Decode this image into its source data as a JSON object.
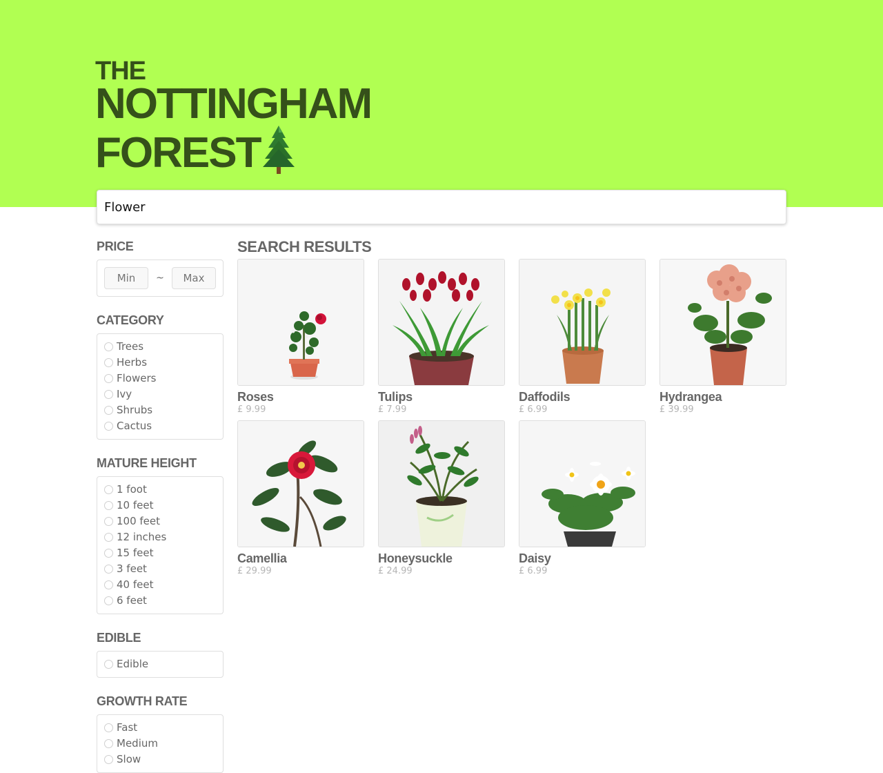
{
  "brand": {
    "line1": "THE",
    "line2": "NOTTINGHAM",
    "line3": "FOREST",
    "logo_icon": "pine-tree-icon",
    "hero_color": "#b1ff52",
    "logo_color": "#35501a"
  },
  "search": {
    "value": "Flower"
  },
  "filters": {
    "price": {
      "title": "PRICE",
      "min_placeholder": "Min",
      "separator": "~",
      "max_placeholder": "Max"
    },
    "category": {
      "title": "CATEGORY",
      "options": [
        "Trees",
        "Herbs",
        "Flowers",
        "Ivy",
        "Shrubs",
        "Cactus"
      ]
    },
    "mature_height": {
      "title": "MATURE HEIGHT",
      "options": [
        "1 foot",
        "10 feet",
        "100 feet",
        "12 inches",
        "15 feet",
        "3 feet",
        "40 feet",
        "6 feet"
      ]
    },
    "edible": {
      "title": "EDIBLE",
      "options": [
        "Edible"
      ]
    },
    "growth_rate": {
      "title": "GROWTH RATE",
      "options": [
        "Fast",
        "Medium",
        "Slow"
      ]
    }
  },
  "results": {
    "title": "SEARCH RESULTS",
    "products": [
      {
        "name": "Roses",
        "price": "£ 9.99",
        "image": "rose-plant-icon"
      },
      {
        "name": "Tulips",
        "price": "£ 7.99",
        "image": "tulip-plant-icon"
      },
      {
        "name": "Daffodils",
        "price": "£ 6.99",
        "image": "daffodil-plant-icon"
      },
      {
        "name": "Hydrangea",
        "price": "£ 39.99",
        "image": "hydrangea-plant-icon"
      },
      {
        "name": "Camellia",
        "price": "£ 29.99",
        "image": "camellia-plant-icon"
      },
      {
        "name": "Honeysuckle",
        "price": "£ 24.99",
        "image": "honeysuckle-plant-icon"
      },
      {
        "name": "Daisy",
        "price": "£ 6.99",
        "image": "daisy-plant-icon"
      }
    ]
  }
}
